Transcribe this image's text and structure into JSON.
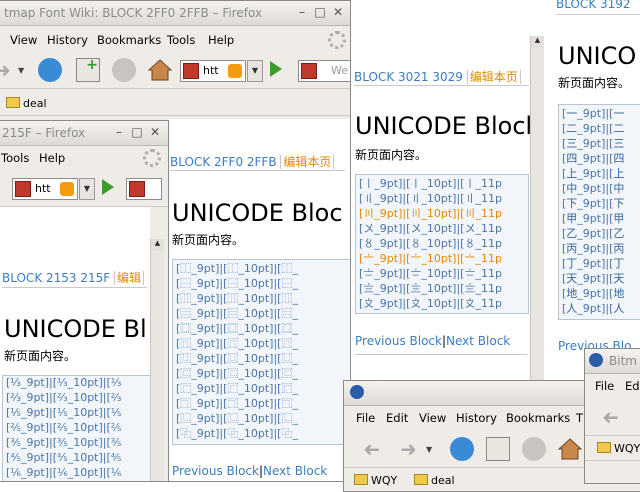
{
  "w1": {
    "title": "tmap Font Wiki: BLOCK 2FF0 2FFB – Firefox",
    "menus": [
      "View",
      "History",
      "Bookmarks",
      "Tools",
      "Help"
    ],
    "url": "htt",
    "search_placeholder": "We",
    "bookmark": "deal"
  },
  "w2": {
    "title": "215F – Firefox",
    "menus": [
      "Tools",
      "Help"
    ],
    "url": "htt"
  },
  "p215": {
    "block": "BLOCK 2153 215F",
    "edit": "编辑",
    "heading": "UNICODE Bl",
    "note": "新页面内容。",
    "rows": [
      "[⅓_9pt]|[⅓_10pt]|[⅓",
      "[⅔_9pt]|[⅔_10pt]|[⅔",
      "[⅕_9pt]|[⅕_10pt]|[⅕",
      "[⅖_9pt]|[⅖_10pt]|[⅖",
      "[⅗_9pt]|[⅗_10pt]|[⅗",
      "[⅘_9pt]|[⅘_10pt]|[⅘",
      "[⅙_9pt]|[⅙_10pt]|[⅙"
    ]
  },
  "p2ff0": {
    "block": "BLOCK 2FF0 2FFB",
    "edit": "编辑本页",
    "heading": "UNICODE Bloc",
    "note": "新页面内容。",
    "rows": [
      "[⿰_9pt]|[⿰_10pt]|[⿰_",
      "[⿱_9pt]|[⿱_10pt]|[⿱_",
      "[⿲_9pt]|[⿲_10pt]|[⿲_",
      "[⿳_9pt]|[⿳_10pt]|[⿳_",
      "[⿴_9pt]|[⿴_10pt]|[⿴_",
      "[⿵_9pt]|[⿵_10pt]|[⿵_",
      "[⿶_9pt]|[⿶_10pt]|[⿶_",
      "[⿷_9pt]|[⿷_10pt]|[⿷_",
      "[⿸_9pt]|[⿸_10pt]|[⿸_",
      "[⿹_9pt]|[⿹_10pt]|[⿹_",
      "[⿺_9pt]|[⿺_10pt]|[⿺_",
      "[⿻_9pt]|[⿻_10pt]|[⿻_"
    ],
    "prev": "Previous Block",
    "sep": "|",
    "next": "Next Block"
  },
  "p3021": {
    "block": "BLOCK 3021 3029",
    "edit": "编辑本页",
    "heading": "UNICODE Block",
    "note": "新页面内容。",
    "rows": [
      "[〡_9pt]|[〡_10pt]|[〡_11p",
      "[〢_9pt]|[〢_10pt]|[〢_11p",
      "[〣_9pt]|[〣_10pt]|[〣_11p",
      "[〤_9pt]|[〤_10pt]|[〤_11p",
      "[〥_9pt]|[〥_10pt]|[〥_11p",
      "[〦_9pt]|[〦_10pt]|[〦_11p",
      "[〧_9pt]|[〧_10pt]|[〧_11p",
      "[〨_9pt]|[〨_10pt]|[〨_11p",
      "[〩_9pt]|[〩_10pt]|[〩_11p"
    ],
    "highlight_rows": [
      2,
      5
    ],
    "prev": "Previous Block",
    "sep": "|",
    "next": "Next Block"
  },
  "p3192": {
    "block": "BLOCK 3192",
    "heading": "UNICO",
    "note": "新页面内容。",
    "rows": [
      "[㆒_9pt]|[㆒",
      "[㆓_9pt]|[㆓",
      "[㆔_9pt]|[㆔",
      "[㆕_9pt]|[㆕",
      "[㆖_9pt]|[㆖",
      "[㆗_9pt]|[㆗",
      "[㆘_9pt]|[㆘",
      "[㆙_9pt]|[㆙",
      "[㆚_9pt]|[㆚",
      "[㆛_9pt]|[㆛",
      "[㆜_9pt]|[㆜",
      "[㆝_9pt]|[㆝",
      "[㆞_9pt]|[㆞",
      "[㆟_9pt]|[㆟"
    ],
    "prev": "Previous Blo"
  },
  "w4": {
    "menus": [
      "File",
      "Edit",
      "View",
      "History",
      "Bookmarks",
      "T"
    ],
    "bookmarks": [
      "WQY",
      "deal"
    ]
  },
  "w5": {
    "title": "Bitm",
    "menus": [
      "File",
      "Edi"
    ],
    "bookmark": "WQY"
  },
  "colors": {
    "link": "#3b7dbf",
    "edit": "#e48800",
    "chrome": "#efebe7"
  }
}
